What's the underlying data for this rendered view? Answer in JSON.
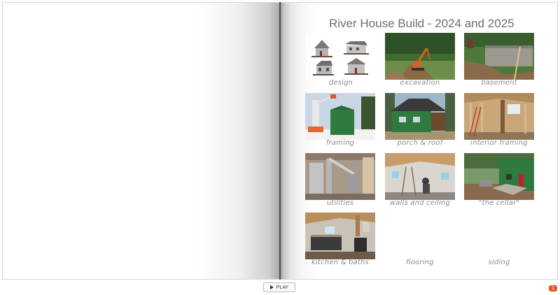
{
  "book": {
    "title": "River House Build - 2024 and 2025",
    "tiles": [
      {
        "caption": "design"
      },
      {
        "caption": "excavation"
      },
      {
        "caption": "basement"
      },
      {
        "caption": "framing"
      },
      {
        "caption": "porch & roof"
      },
      {
        "caption": "interior framing"
      },
      {
        "caption": "utilities"
      },
      {
        "caption": "walls and ceiling"
      },
      {
        "caption": "\"the cellar\""
      },
      {
        "caption": "kitchen & baths"
      },
      {
        "caption": "flooring"
      },
      {
        "caption": "siding"
      }
    ]
  },
  "controls": {
    "play_label": "PLAY",
    "page_badge": "1"
  }
}
